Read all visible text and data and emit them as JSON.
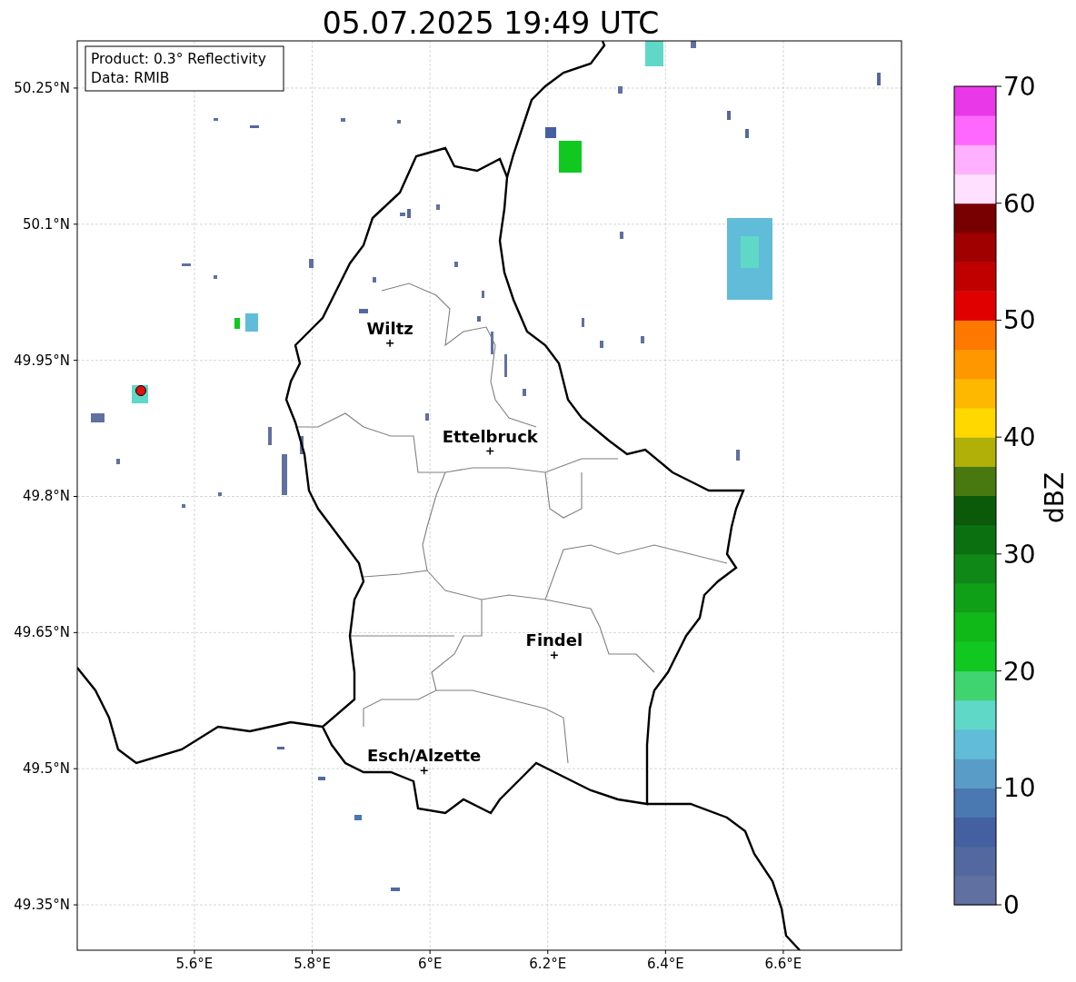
{
  "title": "05.07.2025 19:49 UTC",
  "info_box": [
    "Product: 0.3° Reflectivity",
    "Data: RMIB"
  ],
  "map": {
    "lat_ticks": [
      "50.25°N",
      "50.1°N",
      "49.95°N",
      "49.8°N",
      "49.65°N",
      "49.5°N",
      "49.35°N"
    ],
    "lon_ticks": [
      "5.6°E",
      "5.8°E",
      "6°E",
      "6.2°E",
      "6.4°E",
      "6.6°E"
    ],
    "cities": [
      "Wiltz",
      "Ettelbruck",
      "Findel",
      "Esch/Alzette"
    ]
  },
  "colorbar": {
    "label": "dBZ",
    "ticks": [
      "70",
      "60",
      "50",
      "40",
      "30",
      "20",
      "10",
      "0"
    ]
  }
}
